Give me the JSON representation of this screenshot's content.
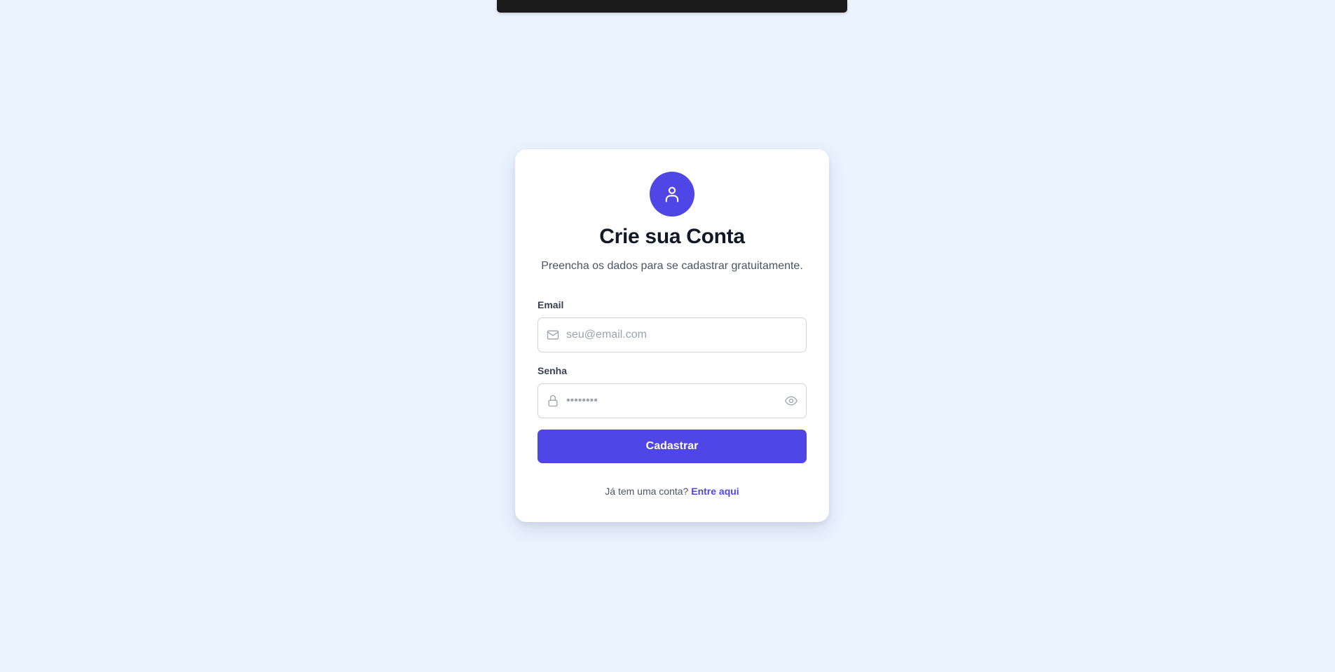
{
  "header": {
    "title": "Crie sua Conta",
    "subtitle": "Preencha os dados para se cadastrar gratuitamente."
  },
  "form": {
    "email": {
      "label": "Email",
      "placeholder": "seu@email.com",
      "value": "",
      "icon": "mail-icon"
    },
    "password": {
      "label": "Senha",
      "placeholder": "••••••••",
      "value": "",
      "icon": "lock-icon",
      "toggle_icon": "eye-icon"
    },
    "submit_label": "Cadastrar"
  },
  "footer": {
    "prompt": "Já tem uma conta?",
    "link_label": "Entre aqui"
  },
  "colors": {
    "background": "#ebf3ff",
    "accent": "#4f46e5",
    "card": "#ffffff",
    "heading": "#111827",
    "muted": "#4b5563"
  }
}
